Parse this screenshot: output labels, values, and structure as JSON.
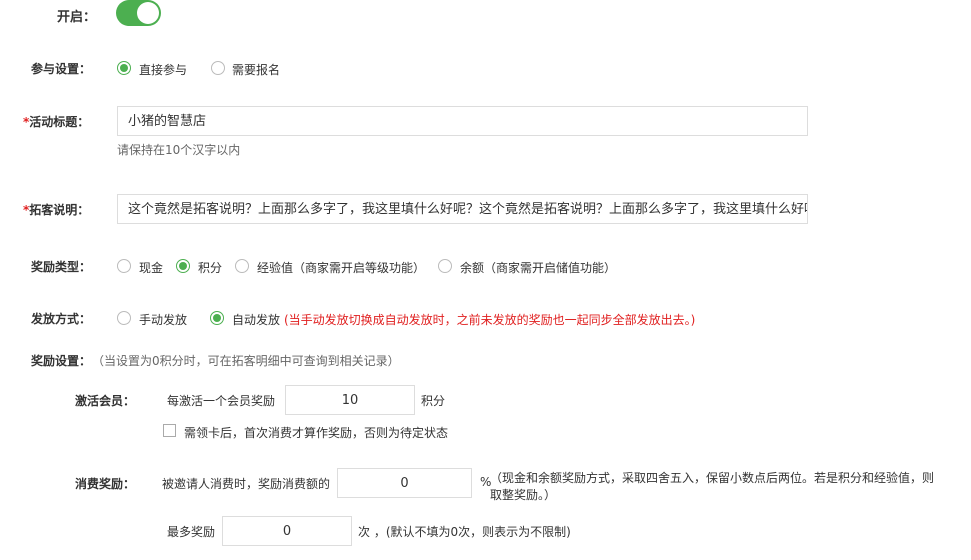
{
  "enable": {
    "label": "开启：",
    "on": true
  },
  "participation": {
    "label": "参与设置：",
    "options": [
      "直接参与",
      "需要报名"
    ],
    "selected": 0
  },
  "title": {
    "required_mark": "*",
    "label": "活动标题：",
    "value": "小猪的智慧店",
    "hint": "请保持在10个汉字以内"
  },
  "description": {
    "required_mark": "*",
    "label": "拓客说明：",
    "value": "这个竟然是拓客说明？上面那么多字了，我这里填什么好呢？这个竟然是拓客说明？上面那么多字了，我这里填什么好呢"
  },
  "reward_type": {
    "label": "奖励类型：",
    "options": [
      "现金",
      "积分",
      "经验值（商家需开启等级功能）",
      "余额（商家需开启储值功能）"
    ],
    "selected": 1
  },
  "issue_method": {
    "label": "发放方式：",
    "options": [
      "手动发放",
      "自动发放"
    ],
    "selected": 1,
    "warning": "(当手动发放切换成自动发放时，之前未发放的奖励也一起同步全部发放出去。)"
  },
  "reward_settings": {
    "label": "奖励设置：",
    "note": "（当设置为0积分时，可在拓客明细中可查询到相关记录）"
  },
  "activate_member": {
    "label": "激活会员：",
    "prefix": "每激活一个会员奖励",
    "value": "10",
    "unit": "积分",
    "checkbox_label": "需领卡后，首次消费才算作奖励，否则为待定状态",
    "checked": false
  },
  "consumption": {
    "label": "消费奖励：",
    "prefix": "被邀请人消费时，奖励消费额的",
    "value": "0",
    "unit": "%",
    "note_line1": "（现金和余额奖励方式，采取四舍五入，保留小数点后两位。若是积分和经验值，则",
    "note_line2": "取整奖励。）",
    "max_label": "最多奖励",
    "max_value": "0",
    "max_note": "次 ，(默认不填为0次，则表示为不限制)"
  }
}
